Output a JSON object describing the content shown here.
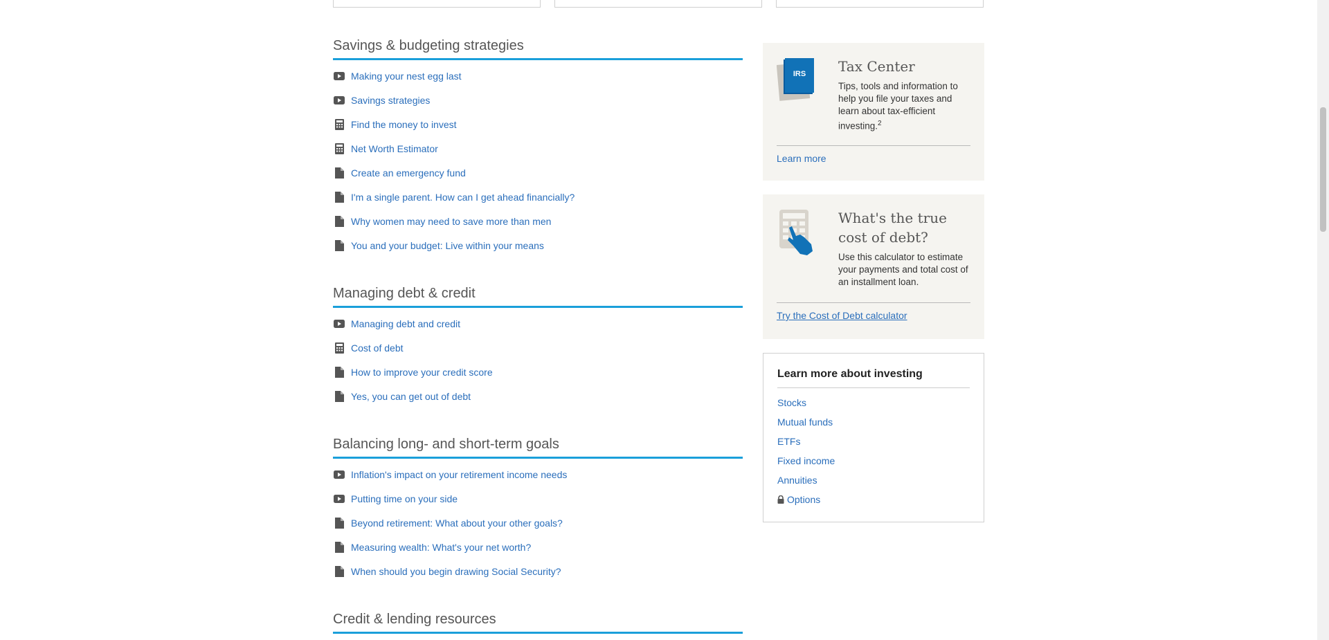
{
  "sections": [
    {
      "title": "Savings & budgeting strategies",
      "items": [
        {
          "icon": "video-icon",
          "label": "Making your nest egg last"
        },
        {
          "icon": "video-icon",
          "label": "Savings strategies"
        },
        {
          "icon": "calculator-icon",
          "label": "Find the money to invest"
        },
        {
          "icon": "calculator-icon",
          "label": "Net Worth Estimator"
        },
        {
          "icon": "document-icon",
          "label": "Create an emergency fund"
        },
        {
          "icon": "document-icon",
          "label": "I'm a single parent. How can I get ahead financially?"
        },
        {
          "icon": "document-icon",
          "label": "Why women may need to save more than men"
        },
        {
          "icon": "document-icon",
          "label": "You and your budget: Live within your means"
        }
      ]
    },
    {
      "title": "Managing debt & credit",
      "items": [
        {
          "icon": "video-icon",
          "label": "Managing debt and credit"
        },
        {
          "icon": "calculator-icon",
          "label": "Cost of debt"
        },
        {
          "icon": "document-icon",
          "label": "How to improve your credit score"
        },
        {
          "icon": "document-icon",
          "label": "Yes, you can get out of debt"
        }
      ]
    },
    {
      "title": "Balancing long- and short-term goals",
      "items": [
        {
          "icon": "video-icon",
          "label": "Inflation's impact on your retirement income needs"
        },
        {
          "icon": "video-icon",
          "label": "Putting time on your side"
        },
        {
          "icon": "document-icon",
          "label": "Beyond retirement: What about your other goals?"
        },
        {
          "icon": "document-icon",
          "label": "Measuring wealth: What's your net worth?"
        },
        {
          "icon": "document-icon",
          "label": "When should you begin drawing Social Security?"
        }
      ]
    },
    {
      "title": "Credit & lending resources",
      "items": []
    }
  ],
  "tax_center": {
    "icon": "irs-icon",
    "icon_text": "IRS",
    "title": "Tax Center",
    "body": "Tips, tools and information to help you file your taxes and learn about tax-efficient investing.",
    "footnote": "2",
    "link": "Learn more"
  },
  "debt_promo": {
    "icon": "calculator-hand-icon",
    "title": "What's the true cost of debt?",
    "body": "Use this calculator to estimate your payments and total cost of an installment loan.",
    "link": "Try the Cost of Debt calculator"
  },
  "learn_more": {
    "title": "Learn more about investing",
    "links": [
      "Stocks",
      "Mutual funds",
      "ETFs",
      "Fixed income",
      "Annuities"
    ],
    "locked_link": "Options",
    "locked_icon": "lock-icon"
  },
  "colors": {
    "accent": "#1a9fda",
    "link": "#2a6ebb",
    "promo_bg": "#f5f4f0"
  }
}
